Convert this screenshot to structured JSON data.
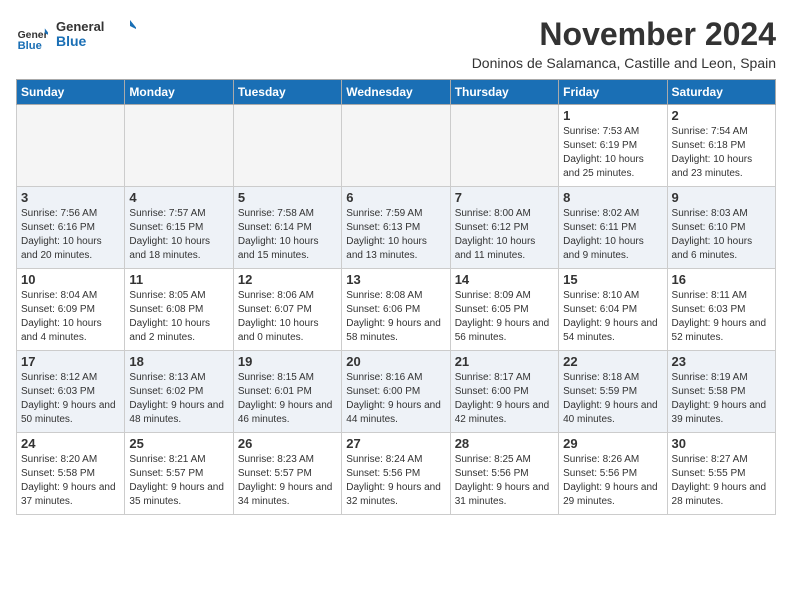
{
  "logo": {
    "general": "General",
    "blue": "Blue"
  },
  "header": {
    "title": "November 2024",
    "subtitle": "Doninos de Salamanca, Castille and Leon, Spain"
  },
  "weekdays": [
    "Sunday",
    "Monday",
    "Tuesday",
    "Wednesday",
    "Thursday",
    "Friday",
    "Saturday"
  ],
  "weeks": [
    [
      {
        "day": "",
        "info": ""
      },
      {
        "day": "",
        "info": ""
      },
      {
        "day": "",
        "info": ""
      },
      {
        "day": "",
        "info": ""
      },
      {
        "day": "",
        "info": ""
      },
      {
        "day": "1",
        "info": "Sunrise: 7:53 AM\nSunset: 6:19 PM\nDaylight: 10 hours and 25 minutes."
      },
      {
        "day": "2",
        "info": "Sunrise: 7:54 AM\nSunset: 6:18 PM\nDaylight: 10 hours and 23 minutes."
      }
    ],
    [
      {
        "day": "3",
        "info": "Sunrise: 7:56 AM\nSunset: 6:16 PM\nDaylight: 10 hours and 20 minutes."
      },
      {
        "day": "4",
        "info": "Sunrise: 7:57 AM\nSunset: 6:15 PM\nDaylight: 10 hours and 18 minutes."
      },
      {
        "day": "5",
        "info": "Sunrise: 7:58 AM\nSunset: 6:14 PM\nDaylight: 10 hours and 15 minutes."
      },
      {
        "day": "6",
        "info": "Sunrise: 7:59 AM\nSunset: 6:13 PM\nDaylight: 10 hours and 13 minutes."
      },
      {
        "day": "7",
        "info": "Sunrise: 8:00 AM\nSunset: 6:12 PM\nDaylight: 10 hours and 11 minutes."
      },
      {
        "day": "8",
        "info": "Sunrise: 8:02 AM\nSunset: 6:11 PM\nDaylight: 10 hours and 9 minutes."
      },
      {
        "day": "9",
        "info": "Sunrise: 8:03 AM\nSunset: 6:10 PM\nDaylight: 10 hours and 6 minutes."
      }
    ],
    [
      {
        "day": "10",
        "info": "Sunrise: 8:04 AM\nSunset: 6:09 PM\nDaylight: 10 hours and 4 minutes."
      },
      {
        "day": "11",
        "info": "Sunrise: 8:05 AM\nSunset: 6:08 PM\nDaylight: 10 hours and 2 minutes."
      },
      {
        "day": "12",
        "info": "Sunrise: 8:06 AM\nSunset: 6:07 PM\nDaylight: 10 hours and 0 minutes."
      },
      {
        "day": "13",
        "info": "Sunrise: 8:08 AM\nSunset: 6:06 PM\nDaylight: 9 hours and 58 minutes."
      },
      {
        "day": "14",
        "info": "Sunrise: 8:09 AM\nSunset: 6:05 PM\nDaylight: 9 hours and 56 minutes."
      },
      {
        "day": "15",
        "info": "Sunrise: 8:10 AM\nSunset: 6:04 PM\nDaylight: 9 hours and 54 minutes."
      },
      {
        "day": "16",
        "info": "Sunrise: 8:11 AM\nSunset: 6:03 PM\nDaylight: 9 hours and 52 minutes."
      }
    ],
    [
      {
        "day": "17",
        "info": "Sunrise: 8:12 AM\nSunset: 6:03 PM\nDaylight: 9 hours and 50 minutes."
      },
      {
        "day": "18",
        "info": "Sunrise: 8:13 AM\nSunset: 6:02 PM\nDaylight: 9 hours and 48 minutes."
      },
      {
        "day": "19",
        "info": "Sunrise: 8:15 AM\nSunset: 6:01 PM\nDaylight: 9 hours and 46 minutes."
      },
      {
        "day": "20",
        "info": "Sunrise: 8:16 AM\nSunset: 6:00 PM\nDaylight: 9 hours and 44 minutes."
      },
      {
        "day": "21",
        "info": "Sunrise: 8:17 AM\nSunset: 6:00 PM\nDaylight: 9 hours and 42 minutes."
      },
      {
        "day": "22",
        "info": "Sunrise: 8:18 AM\nSunset: 5:59 PM\nDaylight: 9 hours and 40 minutes."
      },
      {
        "day": "23",
        "info": "Sunrise: 8:19 AM\nSunset: 5:58 PM\nDaylight: 9 hours and 39 minutes."
      }
    ],
    [
      {
        "day": "24",
        "info": "Sunrise: 8:20 AM\nSunset: 5:58 PM\nDaylight: 9 hours and 37 minutes."
      },
      {
        "day": "25",
        "info": "Sunrise: 8:21 AM\nSunset: 5:57 PM\nDaylight: 9 hours and 35 minutes."
      },
      {
        "day": "26",
        "info": "Sunrise: 8:23 AM\nSunset: 5:57 PM\nDaylight: 9 hours and 34 minutes."
      },
      {
        "day": "27",
        "info": "Sunrise: 8:24 AM\nSunset: 5:56 PM\nDaylight: 9 hours and 32 minutes."
      },
      {
        "day": "28",
        "info": "Sunrise: 8:25 AM\nSunset: 5:56 PM\nDaylight: 9 hours and 31 minutes."
      },
      {
        "day": "29",
        "info": "Sunrise: 8:26 AM\nSunset: 5:56 PM\nDaylight: 9 hours and 29 minutes."
      },
      {
        "day": "30",
        "info": "Sunrise: 8:27 AM\nSunset: 5:55 PM\nDaylight: 9 hours and 28 minutes."
      }
    ]
  ]
}
